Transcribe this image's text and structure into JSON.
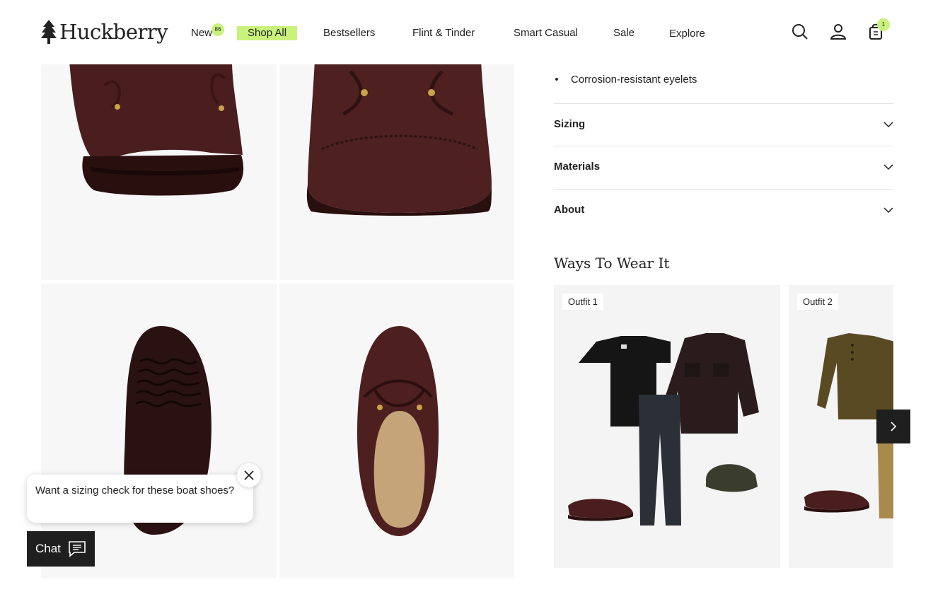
{
  "brand": {
    "name": "Huckberry"
  },
  "nav": {
    "items": [
      {
        "label": "New",
        "badge": "86"
      },
      {
        "label": "Shop All"
      },
      {
        "label": "Bestsellers"
      },
      {
        "label": "Flint & Tinder"
      },
      {
        "label": "Smart Casual"
      },
      {
        "label": "Sale"
      },
      {
        "label": "Explore"
      }
    ],
    "cart_count": "1",
    "icons": [
      "search-icon",
      "account-icon",
      "cart-icon"
    ]
  },
  "details": {
    "bullet": "Corrosion-resistant eyelets",
    "accordions": [
      {
        "label": "Sizing"
      },
      {
        "label": "Materials"
      },
      {
        "label": "About"
      }
    ]
  },
  "ways_to_wear": {
    "title": "Ways To Wear It",
    "outfits": [
      {
        "tag": "Outfit 1"
      },
      {
        "tag": "Outfit 2"
      }
    ]
  },
  "chat": {
    "prompt": "Want a sizing check for these boat shoes?",
    "button_label": "Chat"
  },
  "colors": {
    "accent": "#c9f27c",
    "dark": "#1f1f1f",
    "shoe_leather": "#4a1e1e"
  }
}
